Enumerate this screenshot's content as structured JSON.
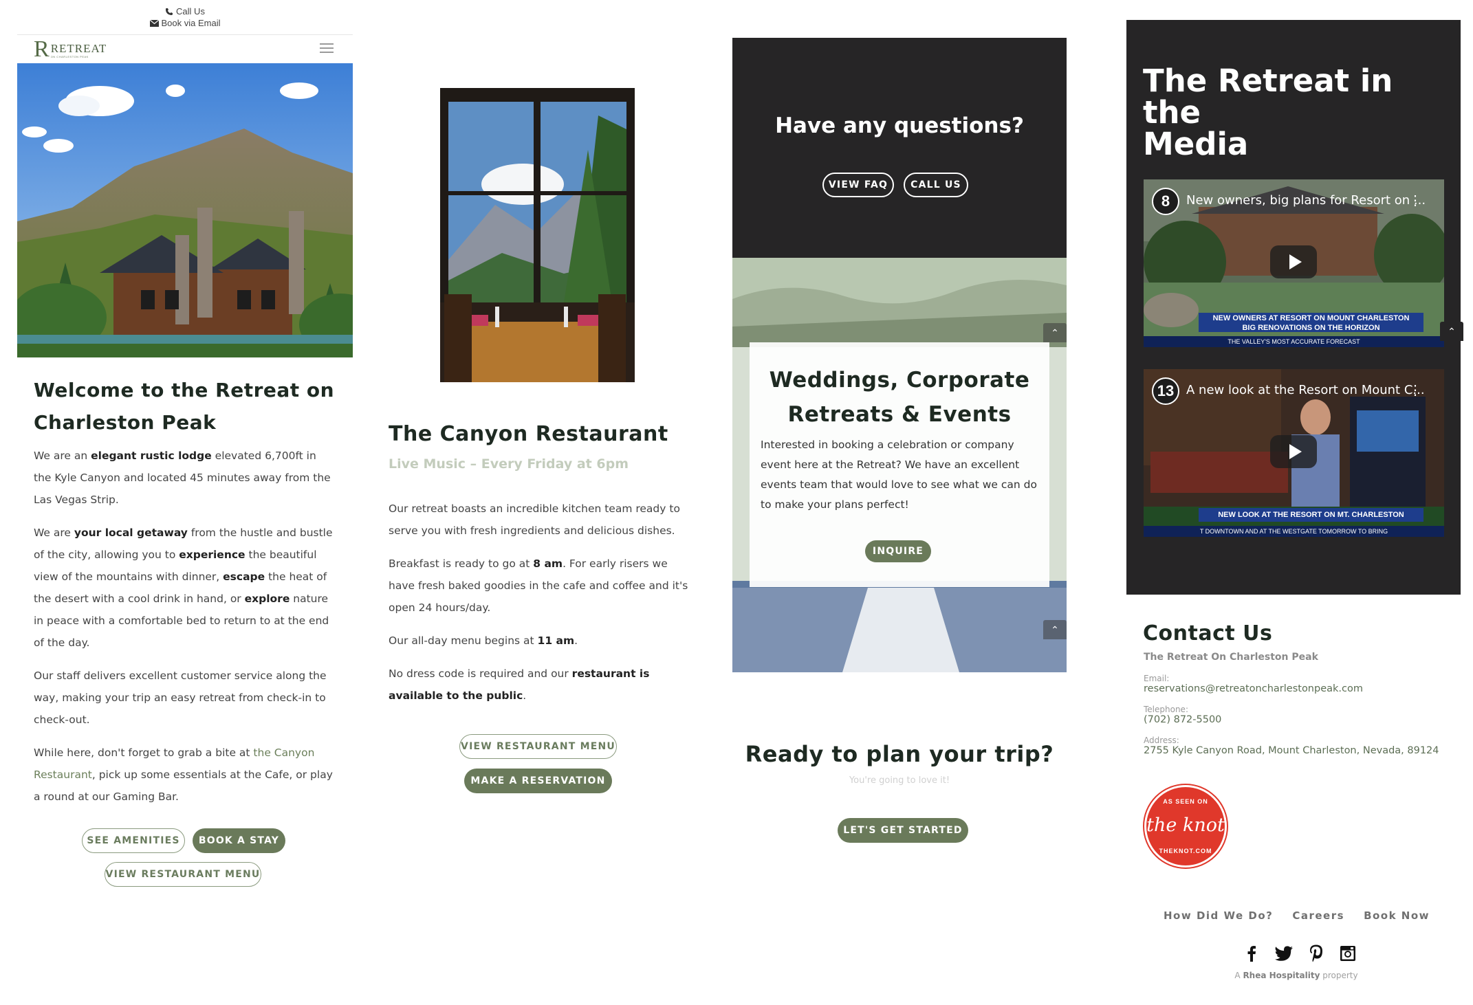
{
  "topbar": {
    "call": "Call Us",
    "email": "Book via Email"
  },
  "logo": {
    "letter": "R",
    "name": "RETREAT",
    "tagline": "ON CHARLESTON PEAK"
  },
  "welcome": {
    "title_line1": "Welcome to the Retreat on",
    "title_line2": "Charleston Peak",
    "p1": {
      "a": "We are an ",
      "b": "elegant rustic lodge",
      "c": " elevated 6,700ft in the Kyle Canyon and located 45 minutes away from the Las Vegas Strip."
    },
    "p2": {
      "a": "We are ",
      "b": "your local getaway",
      "c": " from the hustle and bustle of the city, allowing you to ",
      "d": "experience",
      "e": " the beautiful view of the mountains with dinner, ",
      "f": "escape",
      "g": " the heat of the desert with a cool drink in hand, or ",
      "h": "explore",
      "i": " nature in peace with a comfortable bed to return to at the end of the day."
    },
    "p3": "Our staff delivers excellent customer service along the way, making your trip an easy retreat from check-in to check-out.",
    "p4": {
      "a": "While here, don't forget to grab a bite at ",
      "link": "the Canyon Restaurant",
      "b": ", pick up some essentials at the Cafe, or play a round at our Gaming Bar."
    },
    "buttons": {
      "amenities": "SEE AMENITIES",
      "book": "BOOK A STAY",
      "menu": "VIEW RESTAURANT MENU"
    }
  },
  "restaurant": {
    "title": "The Canyon Restaurant",
    "subtitle": "Live Music – Every Friday at 6pm",
    "p1": "Our retreat boasts an incredible kitchen team ready to serve you with fresh ingredients and delicious dishes.",
    "p2": {
      "a": "Breakfast is ready to go at ",
      "b": "8 am",
      "c": ". For early risers we have fresh baked goodies in the cafe and coffee and it's open 24 hours/day."
    },
    "p3": {
      "a": "Our all-day menu begins at ",
      "b": "11 am",
      "c": "."
    },
    "p4": {
      "a": "No dress code is required and our ",
      "b": "restaurant is available to the public",
      "c": "."
    },
    "buttons": {
      "menu": "VIEW RESTAURANT MENU",
      "reserve": "MAKE A RESERVATION"
    }
  },
  "questions": {
    "title": "Have any questions?",
    "buttons": {
      "faq": "VIEW FAQ",
      "call": "CALL US"
    }
  },
  "events": {
    "title_line1": "Weddings, Corporate",
    "title_line2": "Retreats & Events",
    "body": "Interested in booking a celebration or company event here at the Retreat? We have an excellent events team that would love to see what we can do to make your plans perfect!",
    "button": "INQUIRE"
  },
  "plan": {
    "title": "Ready to plan your trip?",
    "subtitle": "You're going to love it!",
    "button": "LET'S GET STARTED"
  },
  "media": {
    "title_line1": "The Retreat in the",
    "title_line2": "Media",
    "videos": [
      {
        "channel": "8",
        "title": "New owners, big plans for Resort on ...",
        "banner1": "NEW OWNERS AT RESORT ON MOUNT CHARLESTON",
        "banner2": "BIG RENOVATIONS ON THE HORIZON",
        "banner3": "THE VALLEY'S MOST ACCURATE FORECAST"
      },
      {
        "channel": "13",
        "title": "A new look at the Resort on Mount C...",
        "banner1": "NEW LOOK AT THE RESORT ON MT. CHARLESTON",
        "banner2": "",
        "banner3": "T DOWNTOWN AND AT THE WESTGATE TOMORROW TO BRING"
      }
    ]
  },
  "contact": {
    "title": "Contact Us",
    "org": "The Retreat On Charleston Peak",
    "email_label": "Email:",
    "email": "reservations@retreatoncharlestonpeak.com",
    "phone_label": "Telephone:",
    "phone": "(702) 872-5500",
    "address_label": "Address:",
    "address": "2755 Kyle Canyon Road, Mount Charleston, Nevada, 89124"
  },
  "badge": {
    "top": "AS SEEN ON",
    "main": "the knot",
    "bottom": "THEKNOT.COM"
  },
  "footer": {
    "links": [
      "How Did We Do?",
      "Careers",
      "Book Now"
    ],
    "credit_a": "A ",
    "credit_b": "Rhea Hospitality",
    "credit_c": " property"
  },
  "colors": {
    "accent_green": "#6a7a5a",
    "dark_panel": "#262526",
    "knot_red": "#e0382b"
  }
}
